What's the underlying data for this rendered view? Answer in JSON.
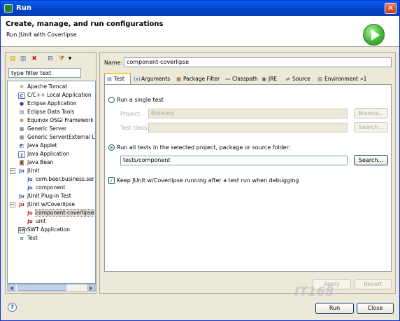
{
  "window": {
    "title": "Run",
    "close_glyph": "✕"
  },
  "header": {
    "title": "Create, manage, and run configurations",
    "subtitle": "Run JUnit with Coverlipse"
  },
  "left": {
    "filter_placeholder": "type filter text",
    "tree": [
      {
        "label": "Apache Tomcat",
        "icon": "tomcat-icon"
      },
      {
        "label": "C/C++ Local Application",
        "icon": "c-app-icon"
      },
      {
        "label": "Eclipse Application",
        "icon": "eclipse-icon"
      },
      {
        "label": "Eclipse Data Tools",
        "icon": "data-tools-icon"
      },
      {
        "label": "Equinox OSGi Framework",
        "icon": "osgi-icon"
      },
      {
        "label": "Generic Server",
        "icon": "server-icon"
      },
      {
        "label": "Generic Server(External La",
        "icon": "server-icon"
      },
      {
        "label": "Java Applet",
        "icon": "applet-icon"
      },
      {
        "label": "Java Application",
        "icon": "java-app-icon"
      },
      {
        "label": "Java Bean",
        "icon": "bean-icon"
      },
      {
        "label": "JUnit",
        "icon": "junit-icon"
      },
      {
        "label": "com.beer.business.ser",
        "icon": "junit-icon"
      },
      {
        "label": "component",
        "icon": "junit-icon"
      },
      {
        "label": "JUnit Plug-in Test",
        "icon": "junit-plugin-icon"
      },
      {
        "label": "JUnit w/Coverlipse",
        "icon": "junit-icon"
      },
      {
        "label": "component-coverlipse",
        "icon": "junit-icon"
      },
      {
        "label": "unit",
        "icon": "junit-icon"
      },
      {
        "label": "SWT Application",
        "icon": "swt-icon"
      },
      {
        "label": "Test",
        "icon": "test-icon"
      }
    ]
  },
  "right": {
    "name_label": "Name:",
    "name_value": "component-coverlipse",
    "tabs": [
      "Test",
      "Arguments",
      "Package Filter",
      "Classpath",
      "JRE",
      "Source",
      "Environment",
      "»1"
    ],
    "test_tab": {
      "single_label": "Run a single test",
      "project_label": "Project:",
      "project_value": "Brewery",
      "browse_label": "Browse...",
      "testclass_label": "Test class:",
      "testclass_value": "",
      "search_label_disabled": "Search...",
      "all_label": "Run all tests in the selected project, package or source folder:",
      "folder_value": "tests/component",
      "search_label": "Search...",
      "keep_label": "Keep JUnit w/Coverlipse running after a test run when debugging"
    },
    "apply_label": "Apply",
    "revert_label": "Revert"
  },
  "footer": {
    "run_label": "Run",
    "close_label": "Close",
    "help_glyph": "?"
  },
  "watermark": "IT168"
}
